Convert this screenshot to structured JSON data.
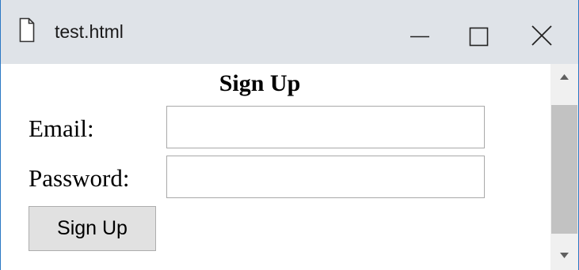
{
  "window": {
    "title": "test.html",
    "icon": "page-icon",
    "controls": [
      "minimize-icon",
      "maximize-icon",
      "close-icon"
    ]
  },
  "form": {
    "heading": "Sign Up",
    "email_label": "Email:",
    "email_value": "",
    "password_label": "Password:",
    "password_value": "",
    "submit_label": "Sign Up"
  },
  "scrollbar": {
    "up_icon": "scroll-up-arrow-icon",
    "down_icon": "scroll-down-arrow-icon"
  },
  "colors": {
    "titlebar_bg": "#dfe3e8",
    "window_border": "#2b78c4",
    "button_bg": "#e1e1e1",
    "scroll_thumb": "#c2c2c2"
  }
}
